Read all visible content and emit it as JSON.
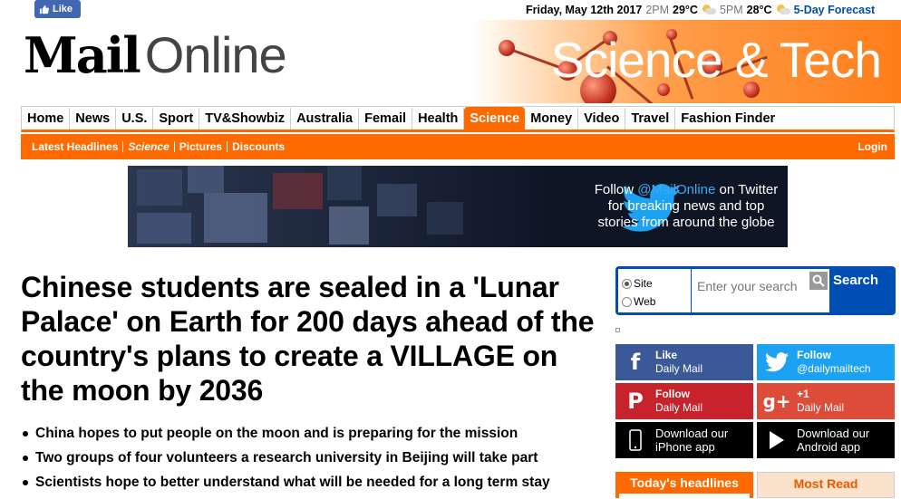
{
  "social_top": {
    "like_label": "Like"
  },
  "datebar": {
    "date": "Friday, May 12th 2017",
    "time1": "2PM",
    "temp1": "29°C",
    "time2": "5PM",
    "temp2": "28°C",
    "forecast_label": "5-Day Forecast"
  },
  "logo": {
    "mail": "Mail",
    "online": "Online"
  },
  "section_banner": {
    "title": "Science & Tech"
  },
  "nav": {
    "items": [
      "Home",
      "News",
      "U.S.",
      "Sport",
      "TV&Showbiz",
      "Australia",
      "Femail",
      "Health",
      "Science",
      "Money",
      "Video",
      "Travel",
      "Fashion Finder"
    ],
    "active": "Science"
  },
  "subnav": {
    "items": [
      "Latest Headlines",
      "Science",
      "Pictures",
      "Discounts"
    ],
    "login": "Login"
  },
  "twitter_banner": {
    "line1_pre": "Follow ",
    "handle": "@MailOnline",
    "line1_post": " on Twitter",
    "line2": "for breaking news and top",
    "line3": "stories from around the globe"
  },
  "article": {
    "headline": "Chinese students are sealed in a 'Lunar Palace' on Earth for 200 days ahead of the country's plans to create a VILLAGE on the moon by 2036",
    "bullets": [
      "China hopes to put people on the moon and is preparing for the mission",
      "Two groups of four volunteers a research university in Beijing will take part",
      "Scientists hope to better understand what will be needed for a long term stay"
    ]
  },
  "search": {
    "option_site": "Site",
    "option_web": "Web",
    "placeholder": "Enter your search",
    "button": "Search"
  },
  "social_links": {
    "facebook": {
      "l1": "Like",
      "l2": "Daily Mail"
    },
    "twitter": {
      "l1": "Follow",
      "l2": "@dailymailtech"
    },
    "pinterest": {
      "l1": "Follow",
      "l2": "Daily Mail"
    },
    "googleplus": {
      "l1": "+1",
      "l2": "Daily Mail"
    },
    "ios": {
      "l1": "Download our",
      "l2": "iPhone app"
    },
    "android": {
      "l1": "Download our",
      "l2": "Android app"
    }
  },
  "tabs": {
    "todays": "Today's headlines",
    "most_read": "Most Read"
  },
  "colors": {
    "brand_orange": "#ff6a00",
    "link_blue": "#004db3",
    "facebook": "#3b5998",
    "twitter": "#1da1f2",
    "pinterest": "#c8232c",
    "googleplus": "#dd4b39"
  }
}
